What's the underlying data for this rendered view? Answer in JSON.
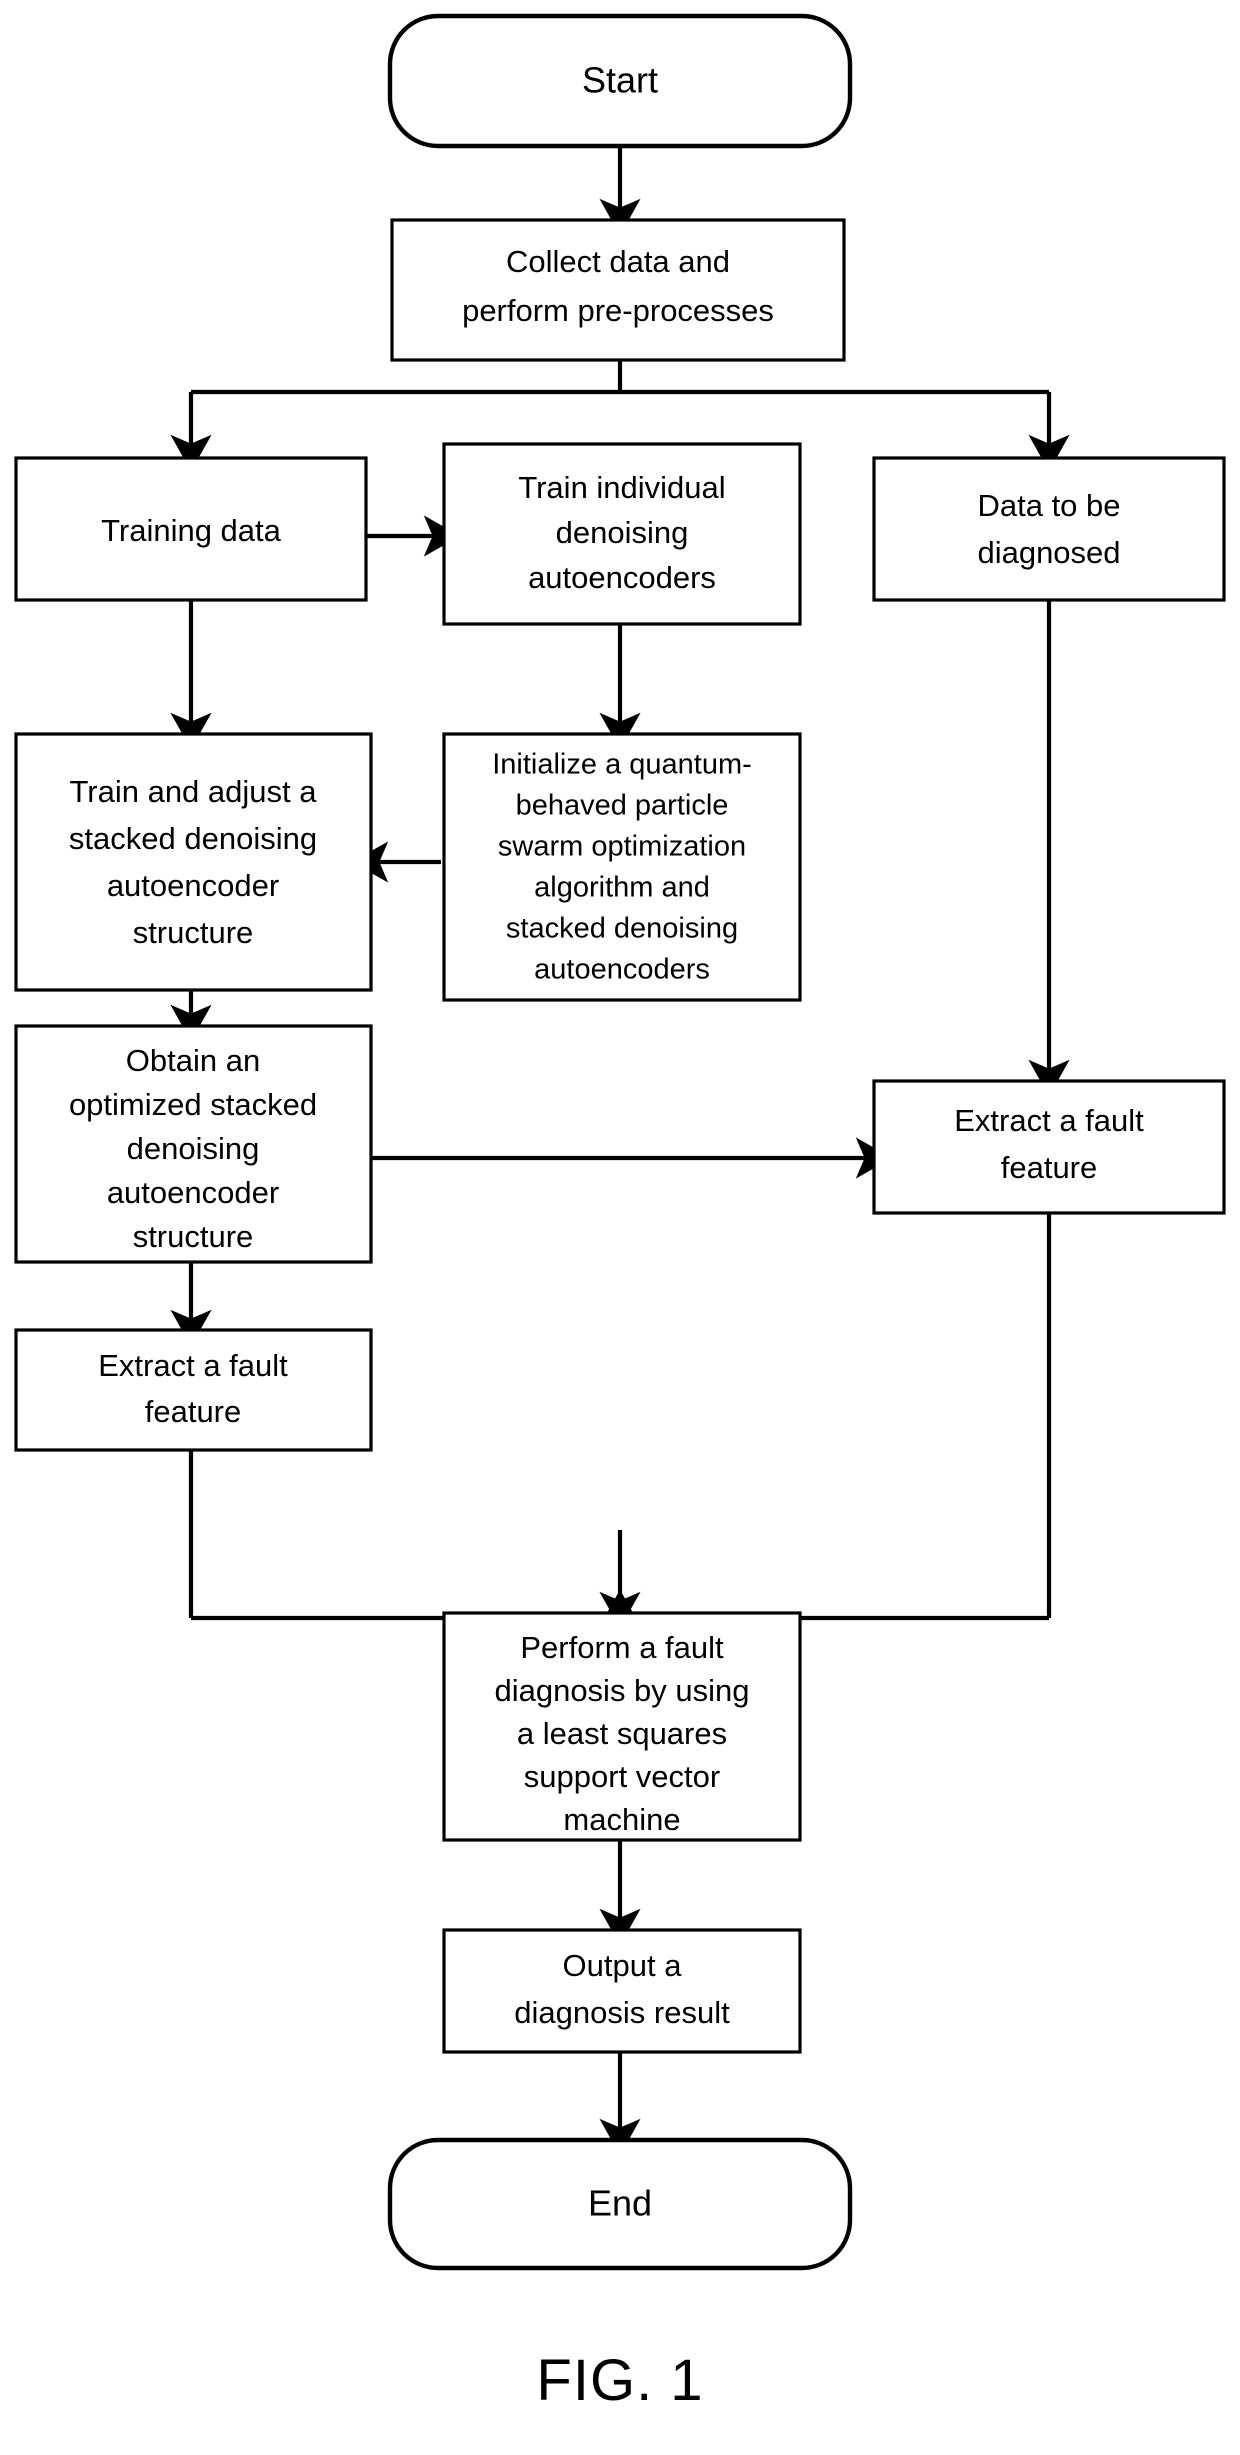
{
  "figure": {
    "caption": "FIG. 1",
    "type": "flowchart",
    "orientation": "top-to-bottom"
  },
  "nodes": [
    {
      "id": "start",
      "shape": "terminal",
      "lines": [
        "Start"
      ]
    },
    {
      "id": "collect",
      "shape": "process",
      "lines": [
        "Collect data and",
        "perform pre-processes"
      ]
    },
    {
      "id": "training_data",
      "shape": "process",
      "lines": [
        "Training data"
      ]
    },
    {
      "id": "train_individual",
      "shape": "process",
      "lines": [
        "Train individual",
        "denoising",
        "autoencoders"
      ]
    },
    {
      "id": "data_to_be_diagnosed",
      "shape": "process",
      "lines": [
        "Data to be",
        "diagnosed"
      ]
    },
    {
      "id": "train_adjust",
      "shape": "process",
      "lines": [
        "Train and adjust a",
        "stacked denoising",
        "autoencoder",
        "structure"
      ]
    },
    {
      "id": "initialize_qpso",
      "shape": "process",
      "lines": [
        "Initialize a quantum-",
        "behaved particle",
        "swarm optimization",
        "algorithm and",
        "stacked denoising",
        "autoencoders"
      ]
    },
    {
      "id": "obtain_optimized",
      "shape": "process",
      "lines": [
        "Obtain an",
        "optimized stacked",
        "denoising",
        "autoencoder",
        "structure"
      ]
    },
    {
      "id": "extract_left",
      "shape": "process",
      "lines": [
        "Extract a fault",
        "feature"
      ]
    },
    {
      "id": "extract_right",
      "shape": "process",
      "lines": [
        "Extract a fault",
        "feature"
      ]
    },
    {
      "id": "perform_diagnosis",
      "shape": "process",
      "lines": [
        "Perform a fault",
        "diagnosis by using",
        "a least squares",
        "support vector",
        "machine"
      ]
    },
    {
      "id": "output_result",
      "shape": "process",
      "lines": [
        "Output a",
        "diagnosis result"
      ]
    },
    {
      "id": "end",
      "shape": "terminal",
      "lines": [
        "End"
      ]
    }
  ],
  "edges": [
    {
      "from": "start",
      "to": "collect"
    },
    {
      "from": "collect",
      "to": "training_data"
    },
    {
      "from": "collect",
      "to": "data_to_be_diagnosed"
    },
    {
      "from": "training_data",
      "to": "train_individual"
    },
    {
      "from": "training_data",
      "to": "train_adjust"
    },
    {
      "from": "train_individual",
      "to": "initialize_qpso"
    },
    {
      "from": "initialize_qpso",
      "to": "train_adjust"
    },
    {
      "from": "train_adjust",
      "to": "obtain_optimized"
    },
    {
      "from": "obtain_optimized",
      "to": "extract_left"
    },
    {
      "from": "obtain_optimized",
      "to": "extract_right"
    },
    {
      "from": "data_to_be_diagnosed",
      "to": "extract_right"
    },
    {
      "from": "extract_left",
      "to": "perform_diagnosis"
    },
    {
      "from": "extract_right",
      "to": "perform_diagnosis"
    },
    {
      "from": "perform_diagnosis",
      "to": "output_result"
    },
    {
      "from": "output_result",
      "to": "end"
    }
  ],
  "colors": {
    "stroke": "#000000",
    "fill": "#ffffff",
    "background": "#ffffff"
  }
}
